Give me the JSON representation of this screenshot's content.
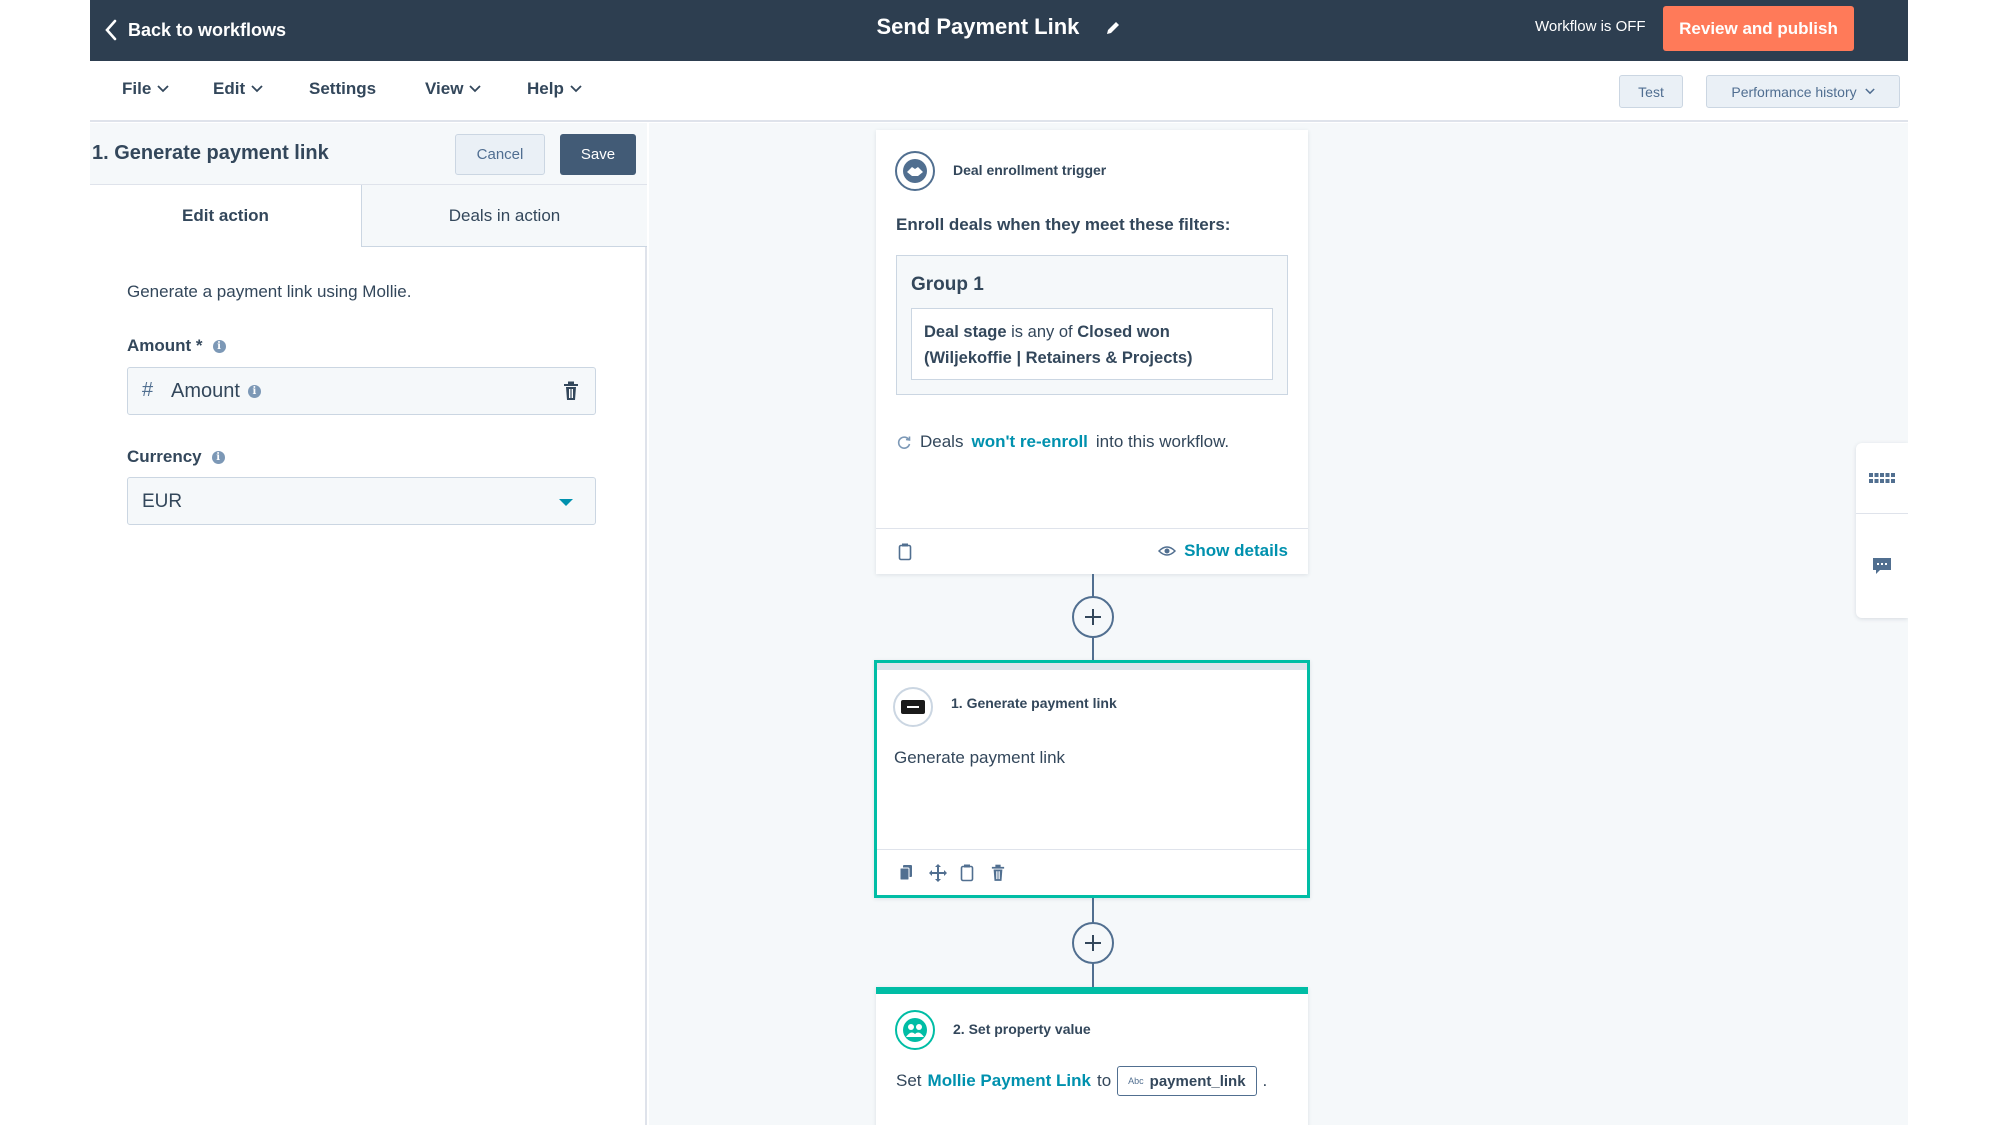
{
  "header": {
    "back_label": "Back to workflows",
    "title": "Send Payment Link",
    "status": "Workflow is OFF",
    "publish_label": "Review and publish",
    "accent_color": "#ff7a59",
    "bar_color": "#2d3e50"
  },
  "menubar": {
    "items": [
      "File",
      "Edit",
      "Settings",
      "View",
      "Help"
    ],
    "test_label": "Test",
    "performance_label": "Performance history"
  },
  "panel": {
    "title": "1. Generate payment link",
    "cancel_label": "Cancel",
    "save_label": "Save",
    "tabs": [
      "Edit action",
      "Deals in action"
    ],
    "description": "Generate a payment link using Mollie.",
    "amount_label": "Amount *",
    "amount_value": "Amount",
    "currency_label": "Currency",
    "currency_value": "EUR"
  },
  "trigger": {
    "title": "Deal enrollment trigger",
    "subtitle": "Enroll deals when they meet these filters:",
    "group_title": "Group 1",
    "filter_property": "Deal stage",
    "filter_operator": "is any of",
    "filter_value": "Closed won (Wiljekoffie | Retainers & Projects)",
    "reenroll_prefix": "Deals",
    "reenroll_link": "won't re-enroll",
    "reenroll_suffix": "into this workflow.",
    "show_details": "Show details"
  },
  "action1": {
    "title": "1. Generate payment link",
    "body": "Generate payment link"
  },
  "action2": {
    "title": "2. Set property value",
    "body_prefix": "Set",
    "property": "Mollie Payment Link",
    "body_mid": "to",
    "token_type": "Abc",
    "token_value": "payment_link",
    "body_suffix": "."
  },
  "icons": {
    "back": "chevron-left-icon",
    "edit": "pencil-icon",
    "trash": "trash-icon",
    "info": "info-icon",
    "handshake": "handshake-icon",
    "refresh": "refresh-icon",
    "eye": "eye-icon",
    "clone": "clone-icon",
    "move": "move-icon",
    "copy": "copy-icon",
    "keyboard": "keyboard-icon",
    "chat": "chat-icon"
  }
}
